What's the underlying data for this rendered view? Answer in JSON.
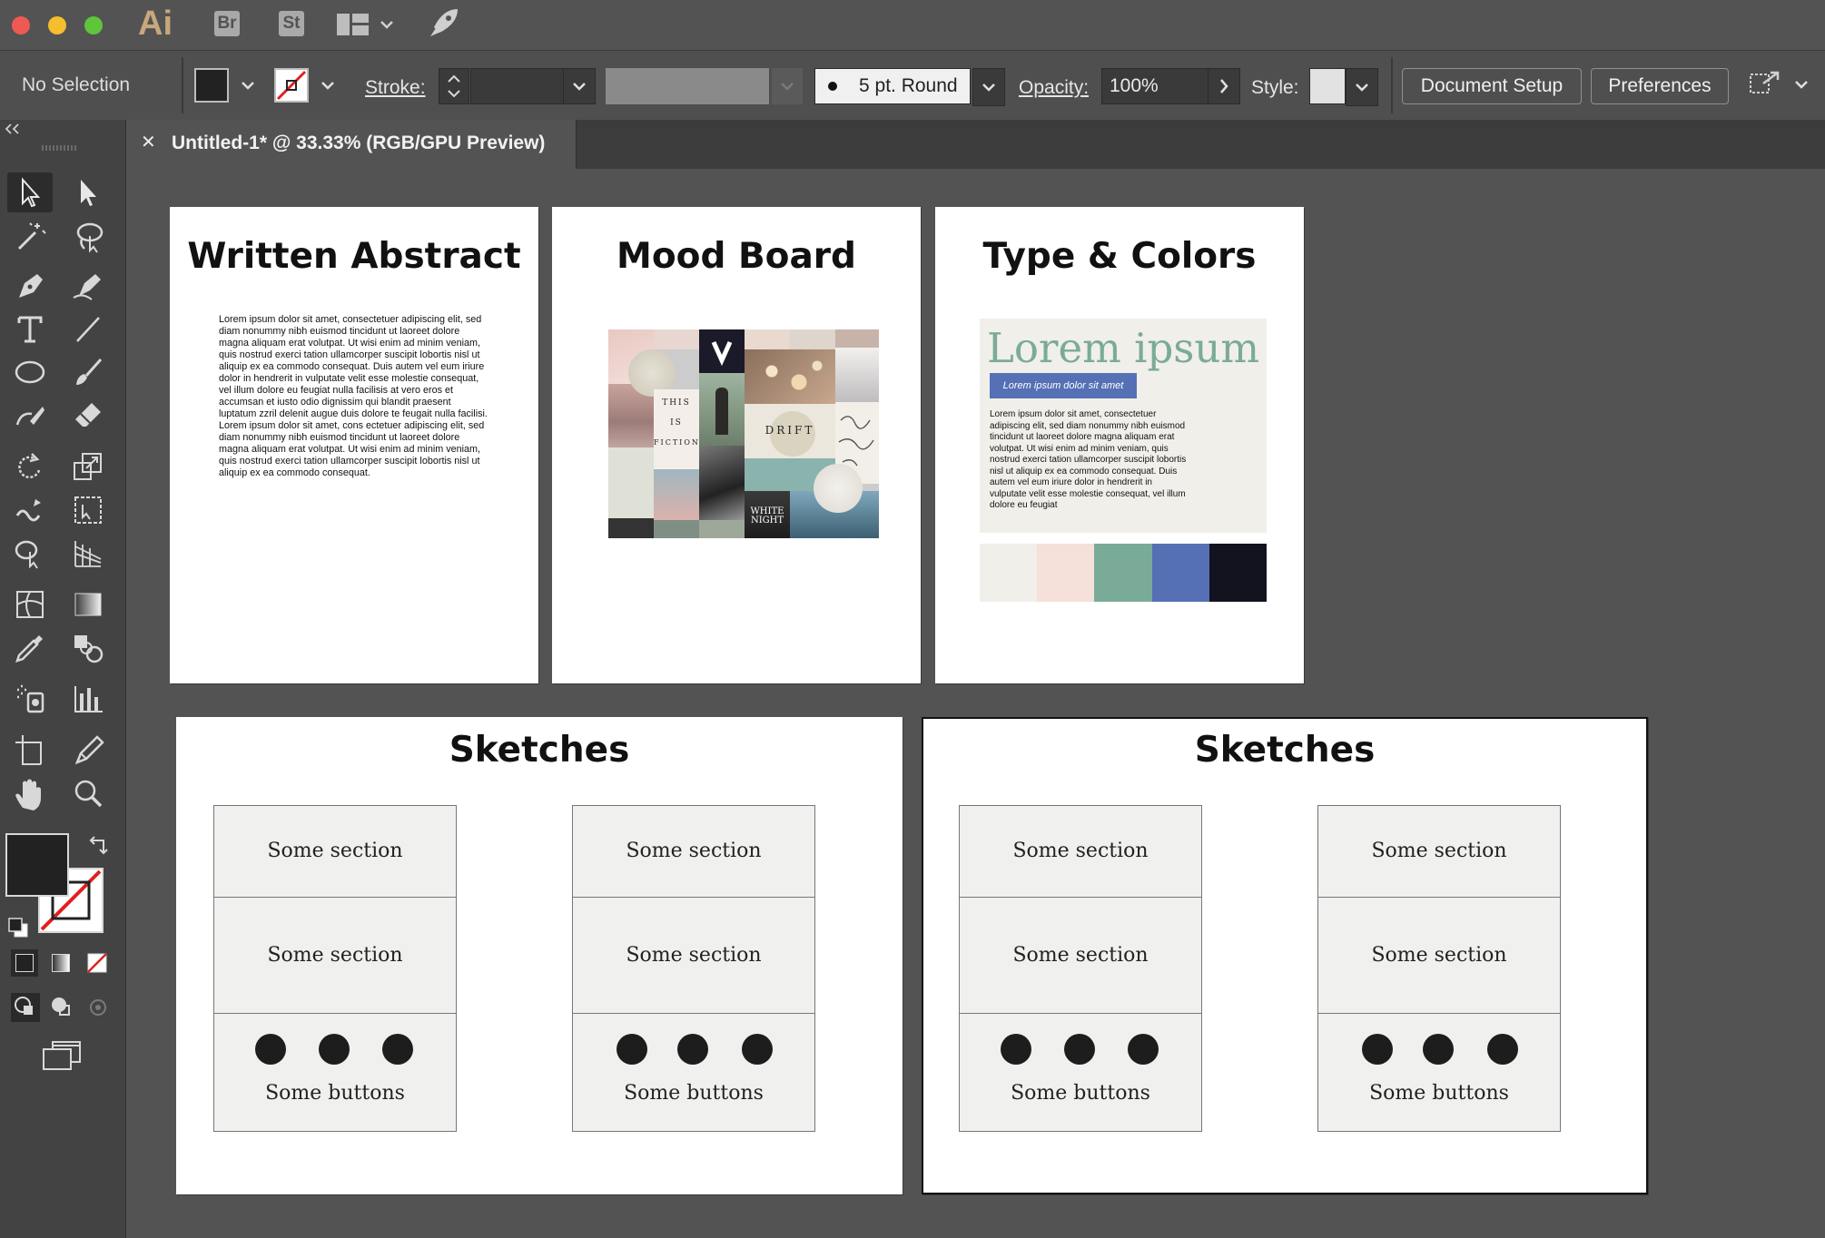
{
  "app": {
    "ai_label": "Ai",
    "br_label": "Br",
    "st_label": "St"
  },
  "control_bar": {
    "selection_status": "No Selection",
    "stroke_label": "Stroke:",
    "brush_value": "5 pt. Round",
    "opacity_label": "Opacity:",
    "opacity_value": "100%",
    "style_label": "Style:",
    "document_setup_label": "Document Setup",
    "preferences_label": "Preferences"
  },
  "tab": {
    "close_glyph": "✕",
    "title": "Untitled-1* @ 33.33% (RGB/GPU Preview)"
  },
  "artboards": {
    "abstract": {
      "title": "Written Abstract",
      "body": "Lorem ipsum dolor sit amet, consectetuer adipiscing elit, sed diam nonummy nibh euismod tincidunt ut laoreet dolore magna aliquam erat volutpat. Ut wisi enim ad minim veniam, quis nostrud exerci tation ullamcorper suscipit lobortis nisl ut aliquip ex ea commodo consequat. Duis autem vel eum iriure dolor in hendrerit in vulputate velit esse molestie consequat, vel illum dolore eu feugiat nulla facilisis at vero eros et accumsan et iusto odio dignissim qui blandit praesent luptatum zzril delenit augue duis dolore te feugait nulla facilisi. Lorem ipsum dolor sit amet, cons ectetuer adipiscing elit, sed diam nonummy nibh euismod tincidunt ut laoreet dolore magna aliquam erat volutpat. Ut wisi enim ad minim veniam, quis nostrud exerci tation ullamcorper suscipit lobortis nisl ut aliquip ex ea commodo consequat."
    },
    "mood": {
      "title": "Mood Board",
      "tile_this": "THIS",
      "tile_is": "IS",
      "tile_fiction": "FICTION",
      "tile_drift": "DRIFT",
      "tile_white_night": "WHITE NIGHT"
    },
    "type_colors": {
      "title": "Type & Colors",
      "heading": "Lorem ipsum",
      "button_text": "Lorem ipsum dolor sit amet",
      "body": "Lorem ipsum dolor sit amet, consectetuer adipiscing elit, sed diam nonummy nibh euismod tincidunt ut laoreet dolore magna aliquam erat volutpat. Ut wisi enim ad minim veniam, quis nostrud exerci tation ullamcorper suscipit lobortis nisl ut aliquip ex ea commodo consequat. Duis autem vel eum iriure dolor in hendrerit in vulputate velit esse molestie consequat, vel illum dolore eu feugiat",
      "swatches": [
        "#f1efe9",
        "#f5e1da",
        "#7aab98",
        "#5570b4",
        "#13121f"
      ]
    },
    "sketches_left": {
      "title": "Sketches",
      "wireframes": [
        {
          "section1": "Some section",
          "section2": "Some section",
          "buttons": "Some buttons"
        },
        {
          "section1": "Some section",
          "section2": "Some section",
          "buttons": "Some buttons"
        }
      ]
    },
    "sketches_right": {
      "title": "Sketches",
      "wireframes": [
        {
          "section1": "Some section",
          "section2": "Some section",
          "buttons": "Some buttons"
        },
        {
          "section1": "Some section",
          "section2": "Some section",
          "buttons": "Some buttons"
        }
      ]
    }
  },
  "colors": {
    "ui_dark": "#535353",
    "panel": "#434343",
    "accent_ai": "#c8a77c",
    "heading_green": "#7aab98",
    "button_blue": "#5570b4"
  }
}
